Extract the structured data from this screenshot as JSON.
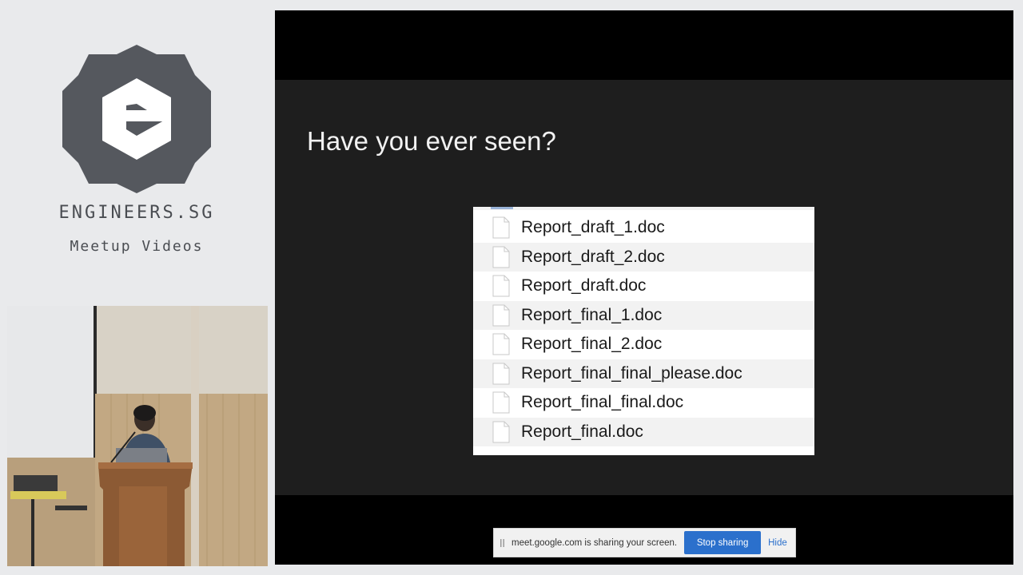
{
  "branding": {
    "name": "ENGINEERS.SG",
    "subtitle": "Meetup Videos"
  },
  "slide": {
    "title": "Have you ever seen?",
    "files": [
      "Report_draft_1.doc",
      "Report_draft_2.doc",
      "Report_draft.doc",
      "Report_final_1.doc",
      "Report_final_2.doc",
      "Report_final_final_please.doc",
      "Report_final_final.doc",
      "Report_final.doc"
    ]
  },
  "sharing_bar": {
    "message": "meet.google.com is sharing your screen.",
    "stop_label": "Stop sharing",
    "hide_label": "Hide"
  },
  "colors": {
    "page_background": "#e9eaec",
    "logo_gray": "#55585e",
    "slide_background": "#1e1e1e",
    "button_blue": "#2b70cc"
  }
}
